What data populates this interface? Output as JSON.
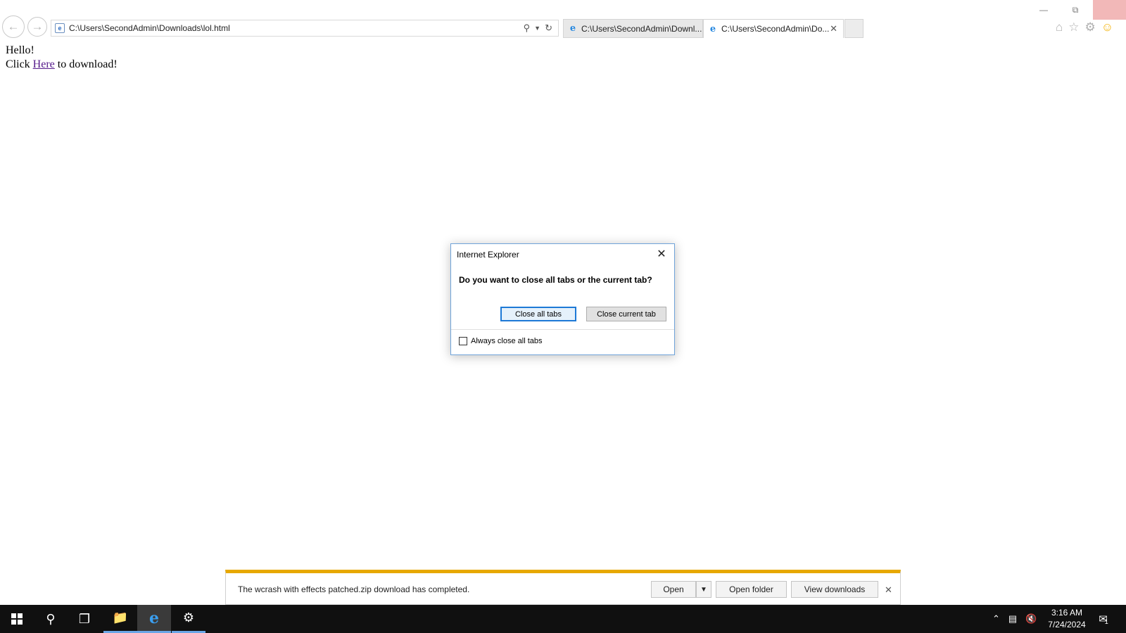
{
  "browser": {
    "address_url": "C:\\Users\\SecondAdmin\\Downloads\\lol.html",
    "tabs": [
      {
        "title": "C:\\Users\\SecondAdmin\\Downl...",
        "active": false
      },
      {
        "title": "C:\\Users\\SecondAdmin\\Do...",
        "active": true
      }
    ],
    "icons": [
      "back-arrow-icon",
      "forward-arrow-icon",
      "search-icon",
      "refresh-icon",
      "home-icon",
      "favorites-star-icon",
      "settings-gear-icon",
      "feedback-smiley-icon"
    ]
  },
  "page": {
    "line1": "Hello!",
    "line2_prefix": "Click ",
    "link_text": "Here",
    "line2_suffix": " to download!"
  },
  "dialog": {
    "title": "Internet Explorer",
    "question": "Do you want to close all tabs or the current tab?",
    "close_all_label": "Close all tabs",
    "close_current_label": "Close current tab",
    "checkbox_label": "Always close all tabs",
    "checkbox_checked": false
  },
  "download_bar": {
    "message": "The wcrash with effects patched.zip download has completed.",
    "open_label": "Open",
    "open_folder_label": "Open folder",
    "view_downloads_label": "View downloads",
    "accent_color": "#e7a800"
  },
  "taskbar": {
    "time": "3:16 AM",
    "date": "7/24/2024",
    "notification_count": "1"
  }
}
